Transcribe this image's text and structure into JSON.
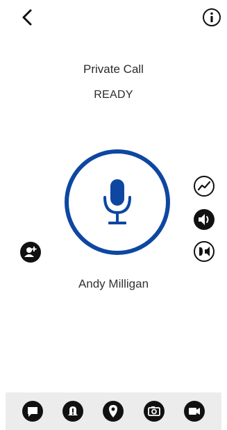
{
  "header": {
    "back_icon": "chevron-left-icon",
    "info_icon": "info-circle-icon"
  },
  "call": {
    "type_label": "Private Call",
    "status_label": "READY",
    "ptt_icon": "microphone-icon"
  },
  "contact": {
    "name": "Andy Milligan"
  },
  "side_controls": [
    {
      "icon": "signal-trend-icon"
    },
    {
      "icon": "speaker-volume-icon"
    },
    {
      "icon": "earpiece-speaker-icon"
    }
  ],
  "add_participant": {
    "icon": "add-user-icon"
  },
  "bottom_bar": [
    {
      "icon": "message-icon"
    },
    {
      "icon": "alert-icon"
    },
    {
      "icon": "location-pin-icon"
    },
    {
      "icon": "camera-icon"
    },
    {
      "icon": "video-icon"
    }
  ],
  "colors": {
    "accent": "#0d47a1",
    "text": "#2a2a2a",
    "bar_bg": "#ececec",
    "icon_dark": "#111111"
  }
}
